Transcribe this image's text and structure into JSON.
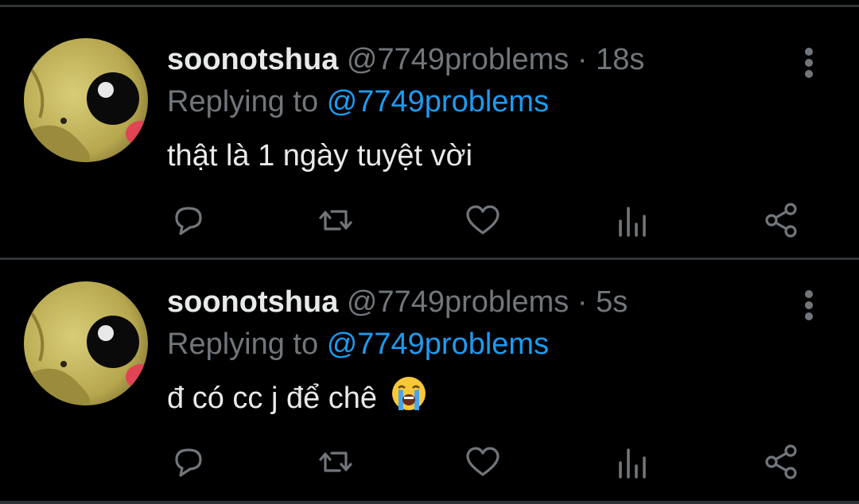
{
  "colors": {
    "background": "#000000",
    "divider": "#2f3336",
    "muted": "#71767b",
    "mention": "#1d9bf0",
    "text": "#e7e9ea"
  },
  "tweets": [
    {
      "display_name": "soonotshua",
      "handle": "@7749problems",
      "separator": "·",
      "time": "18s",
      "replying_prefix": "Replying to",
      "replying_to": "@7749problems",
      "text": "thật là 1 ngày tuyệt vời",
      "emoji": ""
    },
    {
      "display_name": "soonotshua",
      "handle": "@7749problems",
      "separator": "·",
      "time": "5s",
      "replying_prefix": "Replying to",
      "replying_to": "@7749problems",
      "text": "đ có cc j để chê",
      "emoji": "loudly-crying-face"
    }
  ],
  "actions": [
    "reply-icon",
    "retweet-icon",
    "like-icon",
    "analytics-icon",
    "share-icon"
  ]
}
